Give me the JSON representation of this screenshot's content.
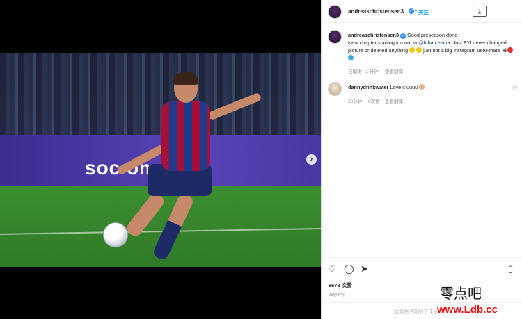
{
  "post": {
    "next_icon": "chevron-right-icon",
    "board_text": "soc   om"
  },
  "header": {
    "username": "andreaschristensen3",
    "verified_icon": "check-icon",
    "separator": "•",
    "follow_label": "关注",
    "download_icon": "download-icon"
  },
  "caption": {
    "username": "andreaschristensen3",
    "line1": "Good preseason done",
    "line2_pre": "New chapter starting tomorrow ",
    "mention": "@fcbarcelona",
    "line2_post": ". Just FYI never changed picture or deleted anything ",
    "line3": " just not a big instagram user-that's all",
    "edited": "已编辑 · 1 分钟",
    "translate": "查看翻译"
  },
  "comment": {
    "username": "dannydrinkwater",
    "text": "Love it uuuu",
    "time": "20分钟",
    "likes": "6次赞",
    "translate": "查看翻译"
  },
  "actions": {
    "like_icon": "heart-icon",
    "comment_icon": "comment-icon",
    "share_icon": "send-icon",
    "save_icon": "bookmark-icon",
    "likes_label": "8678 次赞",
    "posted": "26分钟前",
    "comment_placeholder": "这篇帖子限制了评论"
  },
  "watermark": {
    "text": "零点吧",
    "url": "www.Ldb.cc"
  },
  "colors": {
    "accent": "#0095f6",
    "verified": "#3897f0",
    "watermark_url": "#ee1111"
  }
}
